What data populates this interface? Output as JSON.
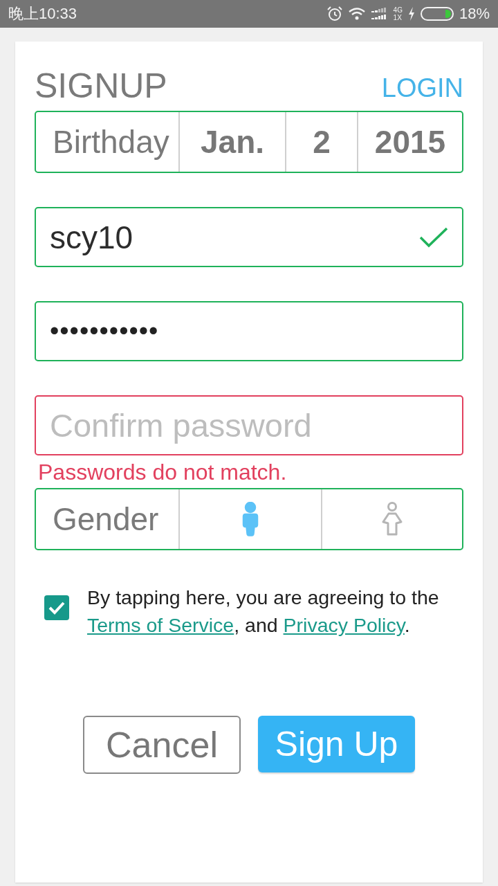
{
  "status_bar": {
    "time": "晚上10:33",
    "network_top": "4G",
    "network_bottom": "1X",
    "battery_text": "18%"
  },
  "header": {
    "title": "SIGNUP",
    "link": "LOGIN"
  },
  "birthday": {
    "invalid": false,
    "label": "Birthday",
    "month": "Jan.",
    "day": "2",
    "year": "2015"
  },
  "fields": [
    {
      "kind": "text",
      "value": "scy10",
      "invalid": false,
      "verified": true
    },
    {
      "kind": "password",
      "value": "•••••••••••",
      "invalid": false,
      "verified": false
    },
    {
      "kind": "password",
      "placeholder": "Confirm password",
      "invalid": true,
      "verified": false,
      "error": "Passwords do not match."
    }
  ],
  "gender": {
    "invalid": false,
    "label": "Gender",
    "options": [
      {
        "kind": "male",
        "selected": true
      },
      {
        "kind": "female",
        "selected": false
      }
    ]
  },
  "agreement": {
    "checked": true,
    "segments": [
      {
        "kind": "text",
        "text": "By tapping here, you are agreeing to the "
      },
      {
        "kind": "link",
        "text": "Terms of Service"
      },
      {
        "kind": "text",
        "text": ", and "
      },
      {
        "kind": "link",
        "text": "Privacy Policy"
      },
      {
        "kind": "text",
        "text": "."
      }
    ]
  },
  "buttons": [
    {
      "kind": "secondary",
      "label": "Cancel"
    },
    {
      "kind": "primary",
      "label": "Sign Up"
    }
  ]
}
